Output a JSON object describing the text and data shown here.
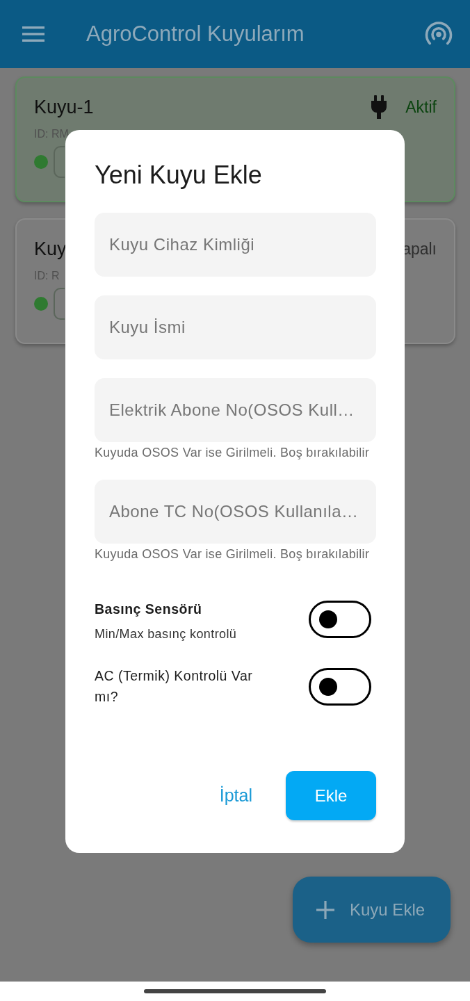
{
  "app_bar": {
    "title": "AgroControl Kuyularım"
  },
  "wells": [
    {
      "name": "Kuyu-1",
      "id": "ID: RM",
      "status": "Aktif",
      "active": true,
      "plug": true,
      "online": true
    },
    {
      "name": "Kuy",
      "id": "ID: R",
      "status": "apalı",
      "active": false,
      "online": true
    }
  ],
  "dialog": {
    "title": "Yeni Kuyu Ekle",
    "fields": [
      {
        "placeholder": "Kuyu Cihaz Kimliği"
      },
      {
        "placeholder": "Kuyu İsmi"
      },
      {
        "placeholder": "Elektrik Abone No(OSOS Kull…",
        "helper": "Kuyuda OSOS Var ise Girilmeli. Boş bırakılabilir"
      },
      {
        "placeholder": "Abone TC No(OSOS Kullanıla…",
        "helper": "Kuyuda OSOS Var ise Girilmeli. Boş bırakılabilir"
      }
    ],
    "switches": [
      {
        "label": "Basınç Sensörü",
        "description": "Min/Max basınç kontrolü",
        "on": false
      },
      {
        "label": "AC (Termik) Kontrolü Var mı?",
        "on": false
      }
    ],
    "buttons": [
      {
        "label": "İptal",
        "kind": "text"
      },
      {
        "label": "Ekle",
        "kind": "filled"
      }
    ]
  },
  "fab": {
    "label": "Kuyu Ekle"
  }
}
